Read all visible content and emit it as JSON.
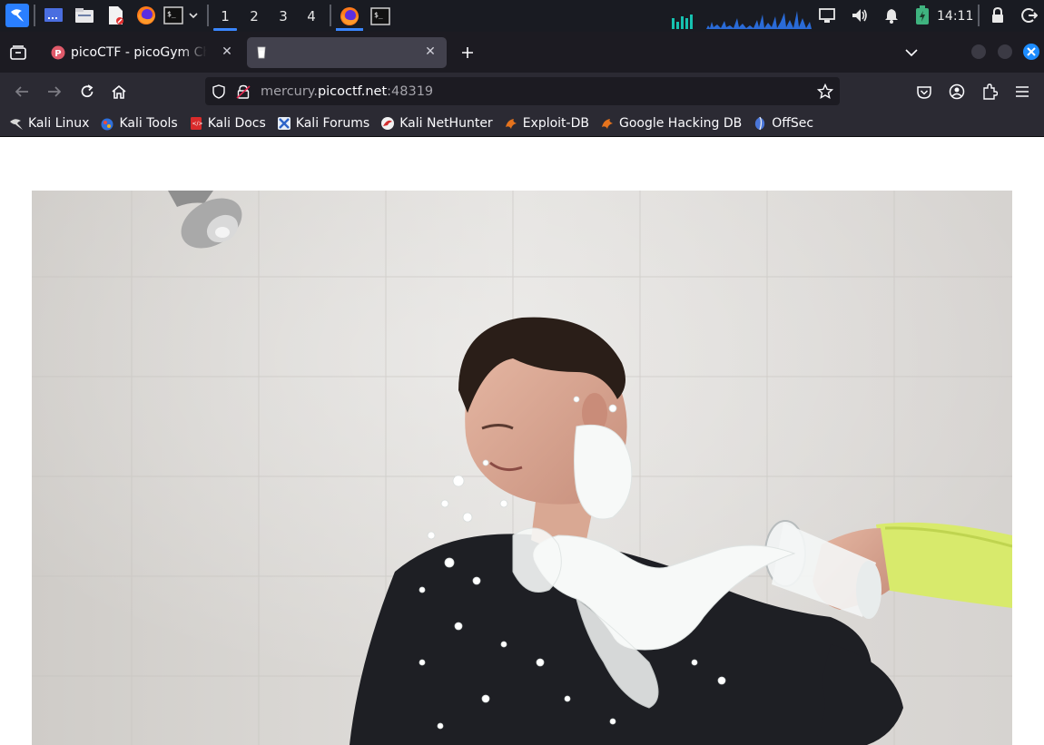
{
  "taskbar": {
    "workspaces": [
      "1",
      "2",
      "3",
      "4"
    ],
    "active_workspace": "1",
    "clock": "14:11",
    "accent": "#3a86ff"
  },
  "tabs": [
    {
      "title": "picoCTF - picoGym Challe",
      "icon": "picoctf-favicon",
      "active": false
    },
    {
      "title": "",
      "icon": "milk-glass-favicon",
      "active": true
    }
  ],
  "url": {
    "prefix": "mercury.",
    "host": "picoctf.net",
    "suffix": ":48319"
  },
  "bookmarks": [
    {
      "label": "Kali Linux",
      "icon": "kali-dragon-icon",
      "color": "#d0d0d0"
    },
    {
      "label": "Kali Tools",
      "icon": "kali-tools-icon",
      "color": "#e74c3c"
    },
    {
      "label": "Kali Docs",
      "icon": "kali-docs-icon",
      "color": "#e02a2a"
    },
    {
      "label": "Kali Forums",
      "icon": "kali-forums-icon",
      "color": "#3a7bd5"
    },
    {
      "label": "Kali NetHunter",
      "icon": "kali-nethunter-icon",
      "color": "#d33"
    },
    {
      "label": "Exploit-DB",
      "icon": "exploit-db-icon",
      "color": "#e0711c"
    },
    {
      "label": "Google Hacking DB",
      "icon": "ghdb-icon",
      "color": "#e0711c"
    },
    {
      "label": "OffSec",
      "icon": "offsec-icon",
      "color": "#5a78d6"
    }
  ],
  "content": {
    "image": "milk-splash-photo"
  }
}
